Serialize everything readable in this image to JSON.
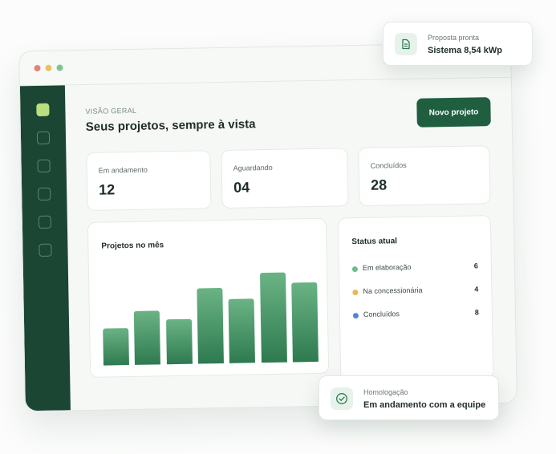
{
  "window": {
    "dots": [
      {
        "name": "close",
        "color": "#e8807a"
      },
      {
        "name": "minimize",
        "color": "#eac25e"
      },
      {
        "name": "maximize",
        "color": "#7ec48f"
      }
    ]
  },
  "sidebar": {
    "items": [
      {
        "icon": "dashboard-icon",
        "active": true
      },
      {
        "icon": "nav-icon",
        "active": false
      },
      {
        "icon": "nav-icon",
        "active": false
      },
      {
        "icon": "nav-icon",
        "active": false
      },
      {
        "icon": "nav-icon",
        "active": false
      },
      {
        "icon": "nav-icon",
        "active": false
      }
    ]
  },
  "header": {
    "overline": "VISÃO GERAL",
    "title": "Seus projetos, sempre à vista",
    "new_project_label": "Novo projeto"
  },
  "stats": [
    {
      "label": "Em andamento",
      "value": "12"
    },
    {
      "label": "Aguardando",
      "value": "04"
    },
    {
      "label": "Concluídos",
      "value": "28"
    }
  ],
  "monthly_chart": {
    "title": "Projetos no mês"
  },
  "chart_data": {
    "type": "bar",
    "title": "Projetos no mês",
    "values": [
      0.41,
      0.6,
      0.5,
      0.84,
      0.71,
      1.0,
      0.88
    ],
    "ylim": [
      0,
      1
    ],
    "grid": false,
    "color": "#3e8a5c"
  },
  "status": {
    "title": "Status atual",
    "items": [
      {
        "label": "Em elaboração",
        "count": "6",
        "color": "#6fbe87"
      },
      {
        "label": "Na concessionária",
        "count": "4",
        "color": "#e9b65a"
      },
      {
        "label": "Concluídos",
        "count": "8",
        "color": "#4a86d9"
      }
    ]
  },
  "notifications": {
    "proposal": {
      "label": "Proposta pronta",
      "value": "Sistema 8,54 kWp",
      "icon": "document-icon"
    },
    "homologation": {
      "label": "Homologação",
      "value": "Em andamento com a equipe",
      "icon": "check-circle-icon"
    }
  },
  "colors": {
    "brand_dark": "#1c4634",
    "accent": "#1f5f40",
    "active_nav": "#b9e07d"
  }
}
